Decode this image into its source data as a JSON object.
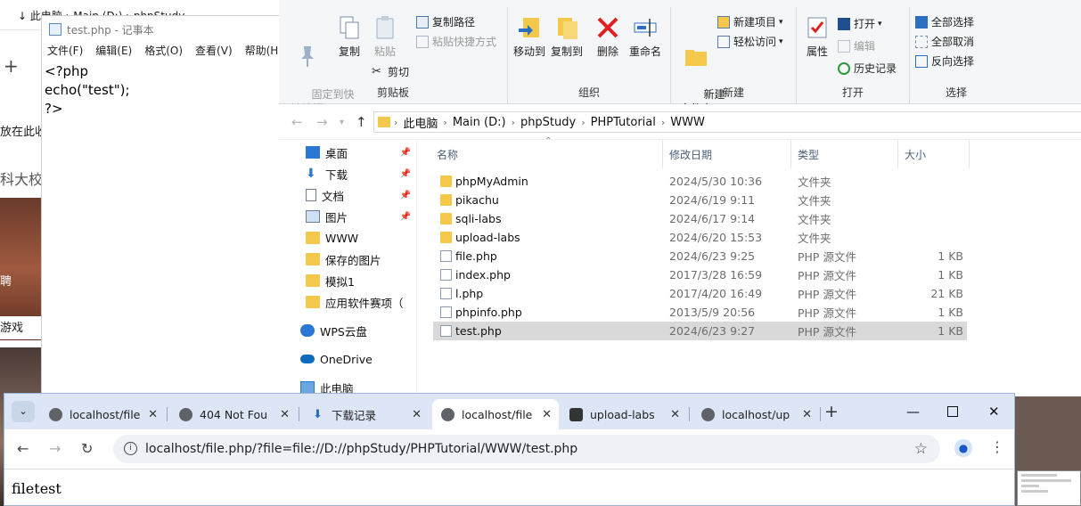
{
  "background_window": {
    "title": "↓    此电脑 › Main (D:) › phpStudy",
    "snippets": [
      "放在此收",
      "科大校测",
      "聘",
      "游戏"
    ]
  },
  "notepad": {
    "title": "test.php - 记事本",
    "menu": [
      "文件(F)",
      "编辑(E)",
      "格式(O)",
      "查看(V)",
      "帮助(H)"
    ],
    "content": "<?php\necho(\"test\");\n?>"
  },
  "ribbon": {
    "clipboard": {
      "label": "剪贴板",
      "pin": "固定到快\n速访问",
      "copy": "复制",
      "paste": "粘贴",
      "copy_path": "复制路径",
      "paste_shortcut": "粘贴快捷方式",
      "cut": "剪切"
    },
    "organize": {
      "label": "组织",
      "move_to": "移动到",
      "copy_to": "复制到",
      "delete": "删除",
      "rename": "重命名"
    },
    "new": {
      "label": "新建",
      "new_folder": "新建\n文件夹",
      "new_item": "新建项目",
      "easy_access": "轻松访问"
    },
    "open": {
      "label": "打开",
      "properties": "属性",
      "open": "打开",
      "edit": "编辑",
      "history": "历史记录"
    },
    "select": {
      "label": "选择",
      "select_all": "全部选择",
      "select_none": "全部取消",
      "invert": "反向选择"
    }
  },
  "address": {
    "crumbs": [
      "此电脑",
      "Main (D:)",
      "phpStudy",
      "PHPTutorial",
      "WWW"
    ]
  },
  "nav": [
    {
      "label": "桌面",
      "icon": "desktop-icon",
      "pinned": true
    },
    {
      "label": "下载",
      "icon": "download-icon",
      "pinned": true
    },
    {
      "label": "文档",
      "icon": "document-icon",
      "pinned": true
    },
    {
      "label": "图片",
      "icon": "picture-icon",
      "pinned": true
    },
    {
      "label": "WWW",
      "icon": "folder-icon",
      "pinned": false
    },
    {
      "label": "保存的图片",
      "icon": "folder-icon",
      "pinned": false
    },
    {
      "label": "模拟1",
      "icon": "folder-icon",
      "pinned": false
    },
    {
      "label": "应用软件赛项（",
      "icon": "folder-icon",
      "pinned": false
    },
    {
      "label": "WPS云盘",
      "icon": "cloud-icon",
      "pinned": false
    },
    {
      "label": "OneDrive",
      "icon": "onedrive-icon",
      "pinned": false
    },
    {
      "label": "此电脑",
      "icon": "computer-icon",
      "pinned": false
    }
  ],
  "columns": {
    "name": "名称",
    "date": "修改日期",
    "type": "类型",
    "size": "大小"
  },
  "files": [
    {
      "name": "phpMyAdmin",
      "date": "2024/5/30 10:36",
      "type": "文件夹",
      "size": "",
      "kind": "folder"
    },
    {
      "name": "pikachu",
      "date": "2024/6/19 9:11",
      "type": "文件夹",
      "size": "",
      "kind": "folder"
    },
    {
      "name": "sqli-labs",
      "date": "2024/6/17 9:14",
      "type": "文件夹",
      "size": "",
      "kind": "folder"
    },
    {
      "name": "upload-labs",
      "date": "2024/6/20 15:53",
      "type": "文件夹",
      "size": "",
      "kind": "folder"
    },
    {
      "name": "file.php",
      "date": "2024/6/23 9:25",
      "type": "PHP 源文件",
      "size": "1 KB",
      "kind": "php"
    },
    {
      "name": "index.php",
      "date": "2017/3/28 16:59",
      "type": "PHP 源文件",
      "size": "1 KB",
      "kind": "php"
    },
    {
      "name": "l.php",
      "date": "2017/4/20 16:49",
      "type": "PHP 源文件",
      "size": "21 KB",
      "kind": "php"
    },
    {
      "name": "phpinfo.php",
      "date": "2013/5/9 20:56",
      "type": "PHP 源文件",
      "size": "1 KB",
      "kind": "php"
    },
    {
      "name": "test.php",
      "date": "2024/6/23 9:27",
      "type": "PHP 源文件",
      "size": "1 KB",
      "kind": "php",
      "selected": true
    }
  ],
  "browser": {
    "tabs": [
      {
        "label": "localhost/file",
        "active": false
      },
      {
        "label": "404 Not Fou",
        "active": false
      },
      {
        "label": "下载记录",
        "active": false
      },
      {
        "label": "localhost/file",
        "active": true
      },
      {
        "label": "upload-labs",
        "active": false
      },
      {
        "label": "localhost/up",
        "active": false
      }
    ],
    "url": "localhost/file.php/?file=file://D://phpStudy/PHPTutorial/WWW/test.php",
    "page_text": "filetest"
  },
  "colors": {
    "ribbon_bg": "#f5f6f7",
    "selected_row": "#d9d9d9",
    "tabbar": "#dce6f6",
    "folder": "#f4c84a",
    "delete_red": "#e02020"
  }
}
